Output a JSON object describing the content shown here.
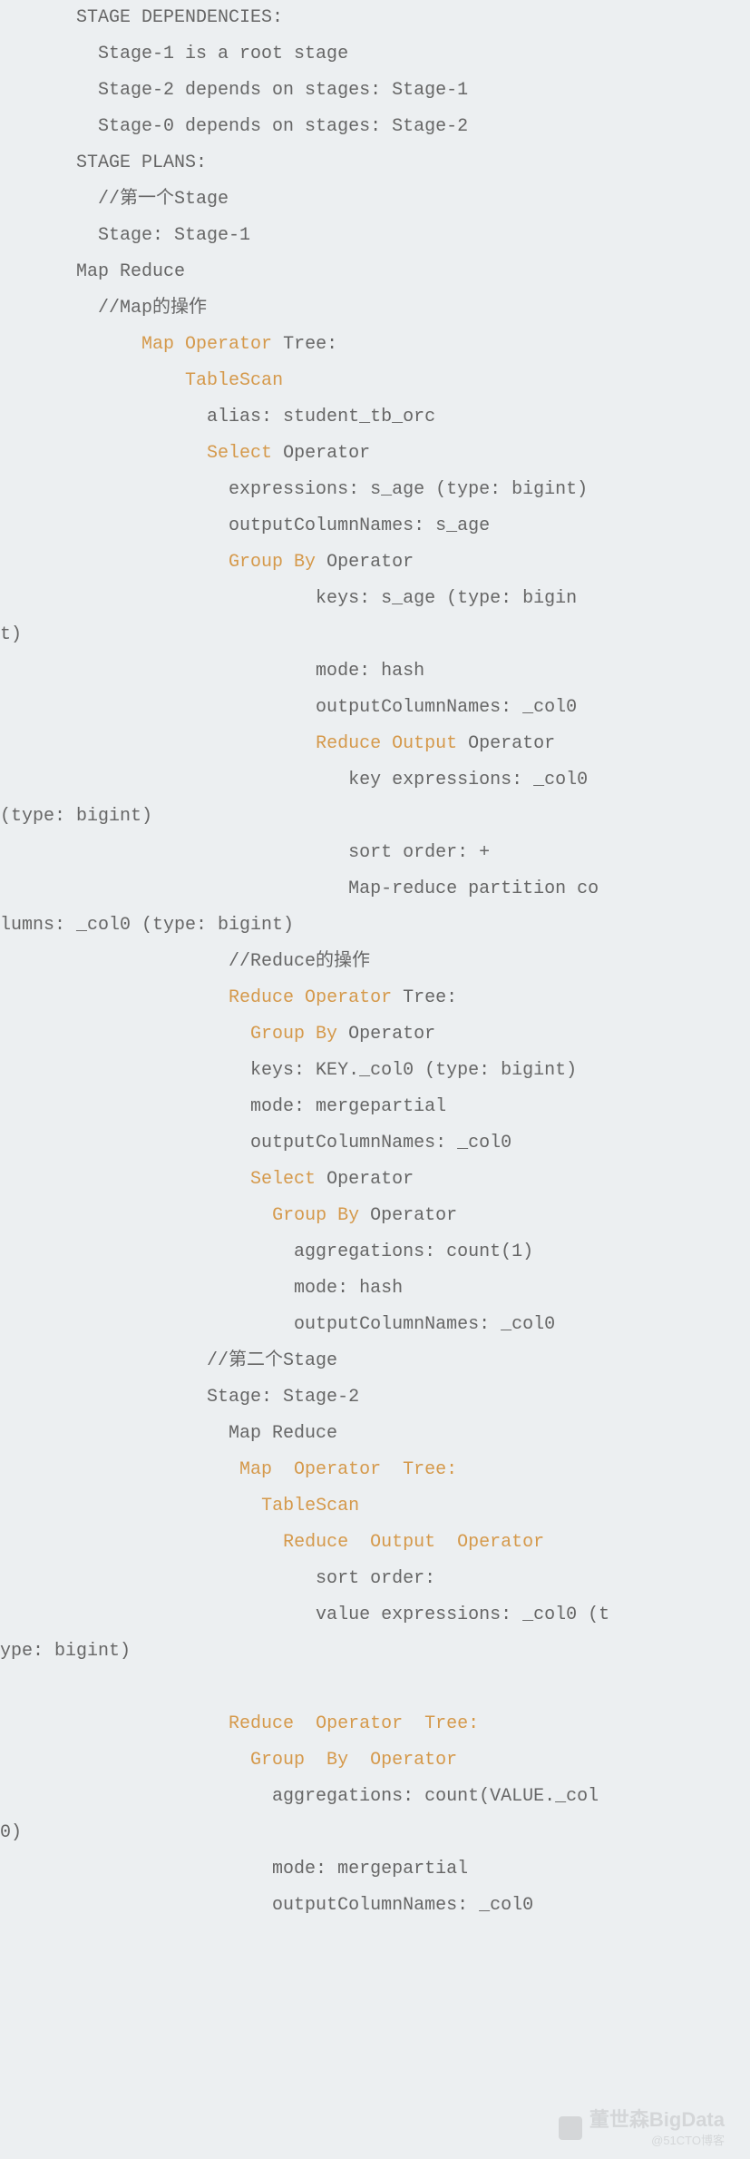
{
  "indent": "       ",
  "header": {
    "title": "STAGE DEPENDENCIES:",
    "dep1": "  Stage-1 is a root stage",
    "dep2": "  Stage-2 depends on stages: Stage-1",
    "dep3": "  Stage-0 depends on stages: Stage-2",
    "plans": "STAGE PLANS:"
  },
  "s1": {
    "c1": "  //第一个Stage",
    "stage": "  Stage: Stage-1",
    "mr": "Map Reduce",
    "mc": "  //Map的操作",
    "mot_pad": "      ",
    "mot1": "Map Operator",
    "mot2": " Tree:",
    "ts_pad": "          ",
    "ts": "TableScan",
    "alias": "            alias: student_tb_orc",
    "sel_pad": "            ",
    "sel": "Select",
    "sel2": " Operator",
    "expr": "              expressions: s_age (type: bigint)",
    "ocn1": "              outputColumnNames: s_age",
    "gb_pad": "              ",
    "gb": "Group By",
    "gb2": " Operator",
    "keys_a": "                      keys: s_age (type: bigin",
    "keys_b": "t)",
    "mode_h": "                      mode: hash",
    "ocn2": "                      outputColumnNames: _col0",
    "roo_pad": "                      ",
    "roo1": "Reduce Output",
    "roo2": " Operator",
    "kexp_a": "                         key expressions: _col0 ",
    "kexp_b": "(type: bigint)",
    "sort": "                         sort order: +",
    "part_a": "                         Map-reduce partition co",
    "part_b": "lumns: _col0 (type: bigint)",
    "rc": "              //Reduce的操作",
    "rot_pad": "              ",
    "rot1": "Reduce Operator",
    "rot2": " Tree:",
    "rgb_pad": "                ",
    "rgb1": "Group By ",
    "rgb2": "Operator",
    "rkeys": "                keys: KEY._col0 (type: bigint)",
    "rmode": "                mode: mergepartial",
    "rocn": "                outputColumnNames: _col0",
    "rsel_pad": "                ",
    "rsel1": "Select",
    "rsel2": " Operator",
    "rgb2_pad": "                  ",
    "rgb2a": "Group By ",
    "rgb2b": "Operator",
    "ragg": "                    aggregations: count(1)",
    "rmode2": "                    mode: hash",
    "rocn2": "                    outputColumnNames: _col0"
  },
  "s2": {
    "c": "            //第二个Stage",
    "stage": "            Stage: Stage-2",
    "mr": "              Map Reduce",
    "mot_pad": "               ",
    "mot": "Map  Operator  Tree:",
    "ts_pad": "                 ",
    "ts": "TableScan",
    "roo_pad": "                   ",
    "roo": "Reduce  Output  Operator",
    "sort": "                      sort order:",
    "vexp_a": "                      value expressions: _col0 (t",
    "vexp_b": "ype: bigint)",
    "blank": " ",
    "rot_pad": "              ",
    "rot": "Reduce  Operator  Tree:",
    "gb_pad": "                ",
    "gb": "Group  By  Operator",
    "agg_a": "                  aggregations: count(VALUE._col",
    "agg_b": "0)",
    "mode": "                  mode: mergepartial",
    "ocn": "                  outputColumnNames: _col0"
  },
  "watermark": {
    "main": "董世森BigData",
    "sub": "@51CTO博客"
  }
}
